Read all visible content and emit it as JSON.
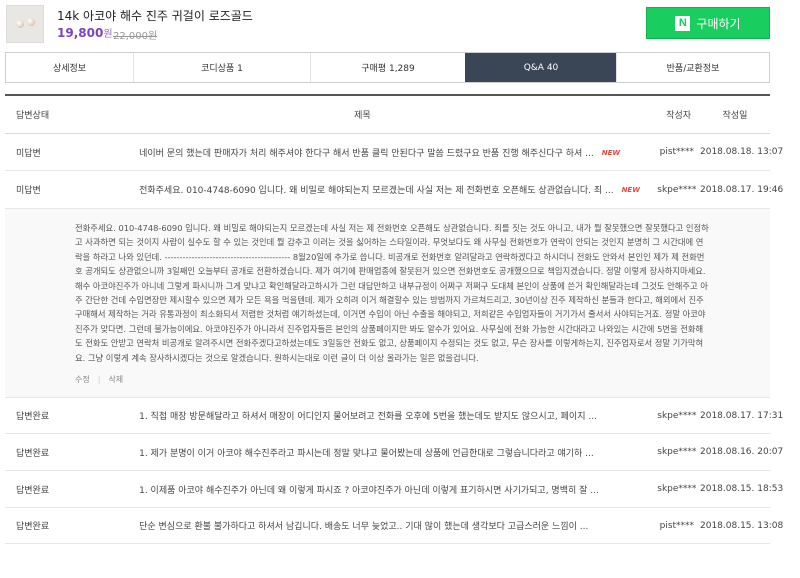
{
  "product": {
    "title": "14k 아코야 해수 진주 귀걸이 로즈골드",
    "price": "19,800",
    "price_unit": "원",
    "original_price": "22,000원",
    "buy_label": "구매하기",
    "buy_logo": "N"
  },
  "tabs": [
    {
      "label": "상세정보"
    },
    {
      "label": "코디상품 1"
    },
    {
      "label": "구매평 1,289"
    },
    {
      "label": "Q&A 40",
      "active": true
    },
    {
      "label": "반품/교환정보"
    }
  ],
  "table": {
    "headers": {
      "status": "답변상태",
      "title": "제목",
      "writer": "작성자",
      "date": "작성일"
    },
    "rows": [
      {
        "status": "미답변",
        "title": "네이버 문의 했는데 판매자가 처리 해주셔야 한다구 해서 반품 클릭 안된다구 말씀 드렸구요 반품 진행 해주신다구 하셔 ...",
        "new": "NEW",
        "writer": "pist****",
        "date": "2018.08.18. 13:07"
      },
      {
        "status": "미답변",
        "title": "전화주세요. 010-4748-6090 입니다. 왜 비밀로 해야되는지 모르겠는데 사실 저는 제 전화번호 오픈해도 상관없습니다. 죄 ...",
        "new": "NEW",
        "writer": "skpe****",
        "date": "2018.08.17. 19:46"
      }
    ],
    "detail": {
      "body": "전화주세요. 010-4748-6090 입니다. 왜 비밀로 해야되는지 모르겠는데 사실 저는 제 전화번호 오픈해도 상관없습니다. 죄를 짓는 것도 아니고, 내가 뭘 잘못했으면 잘못했다고 인정하고 사과하면 되는 것이지 사람이 실수도 할 수 있는 것인데 뭘 감추고 이러는 것을 싫어하는 스타일이라. 무엇보다도 왜 사무실 전화번호가 연락이 안되는 것인지 분명히 그 시간대에 연락을 하라고 나와 있던데. ------------------------------------------ 8월20일에 추가로 씁니다. 비공개로 전화번호 알려달라고 연락하겠다고 하시더니 전화도 안와서 본인인 제가 제 전화번호 공개되도 상관없으니까 3일째인 오늘부터 공개로 전환하겠습니다. 제가 여기에 판매업종에 잘못된거 있으면 전화번호도 공개했으므로 책임지겠습니다. 정말 이렇게 장사하지마세요. 해수 아코야진주가 아니네 그렇게 파시니까 그게 맞냐고 확인해달라고하시가 그런 대답만하고 내부규정이 어쩌구 저쩌구 도대체 본인이 상품에 쓴거 확인해달라는데 그것도 안해주고 아주 간단한 건데 수입면장만 제시할수 있으면 제가 모든 욕을 먹을텐데. 제가 오히려 이거 해결할수 있는 방법까지 가르쳐드리고, 30년이상 진주 제작하신 분들과 한다고, 해외에서 진주 구매해서 제작하는 거라 유통과정이 최소화되서 저렴한 것처럼 얘기하셨는데, 이거면 수입이 아닌 수출을 해야되고, 저희같은 수입업자들이 거기가서 줄서서 사야되는거죠. 정말 아코야진주가 맞다면. 그런데 불가능이에요. 아코야진주가 아니라서 진주업자들은 본인의 상품페이지만 봐도 알수가 있어요. 사무실에 전화 가능한 시간대라고 나와있는 시간에 5번을 전화해도 전화도 안받고 연락처 비공개로 알려주시면 전화주겠다고하셨는데도 3일동안 전화도 없고, 상품페이지 수정되는 것도 없고, 무슨 장사를 이렇게하는지, 진주업자로서 정말 기가막혀요. 그냥 이렇게 계속 장사하시겠다는 것으로 알겠습니다. 원하시는대로 이런 글이 더 이상 올라가는 일은 없을겁니다.",
      "edit_label": "수정",
      "delete_label": "삭제"
    },
    "rows_after": [
      {
        "status": "답변완료",
        "title": "1. 직접 매장 방문해달라고 하셔서 매장이 어디인지 물어보려고 전화를 오후에 5번을 했는데도 받지도 않으시고, 페이지 ...",
        "writer": "skpe****",
        "date": "2018.08.17. 17:31"
      },
      {
        "status": "답변완료",
        "title": "1. 제가 분명이 이거 아코야 해수진주라고 파시는데 정말 맞냐고 물어봤는데 상품에 언급한대로 그렇습니다라고 얘기하 ...",
        "writer": "skpe****",
        "date": "2018.08.16. 20:07"
      },
      {
        "status": "답변완료",
        "title": "1. 이제품 아코야 해수진주가 아닌데 왜 이렇게 파시죠 ? 아코야진주가 아닌데 이렇게 표기하시면 사기가되고, 명백히 잘 ...",
        "writer": "skpe****",
        "date": "2018.08.15. 18:53"
      },
      {
        "status": "답변완료",
        "title": "단순 변심으로 환불 불가하다고 하셔서 남깁니다. 배송도 너무 늦었고.. 기대 많이 했는데 생각보다 고급스러운 느낌이 ...",
        "writer": "pist****",
        "date": "2018.08.15. 13:08"
      }
    ]
  },
  "colors": {
    "accent": "#7b44c2",
    "buy_green": "#19ce5f",
    "active_tab": "#3a4556",
    "new_badge": "#e14b3b"
  }
}
